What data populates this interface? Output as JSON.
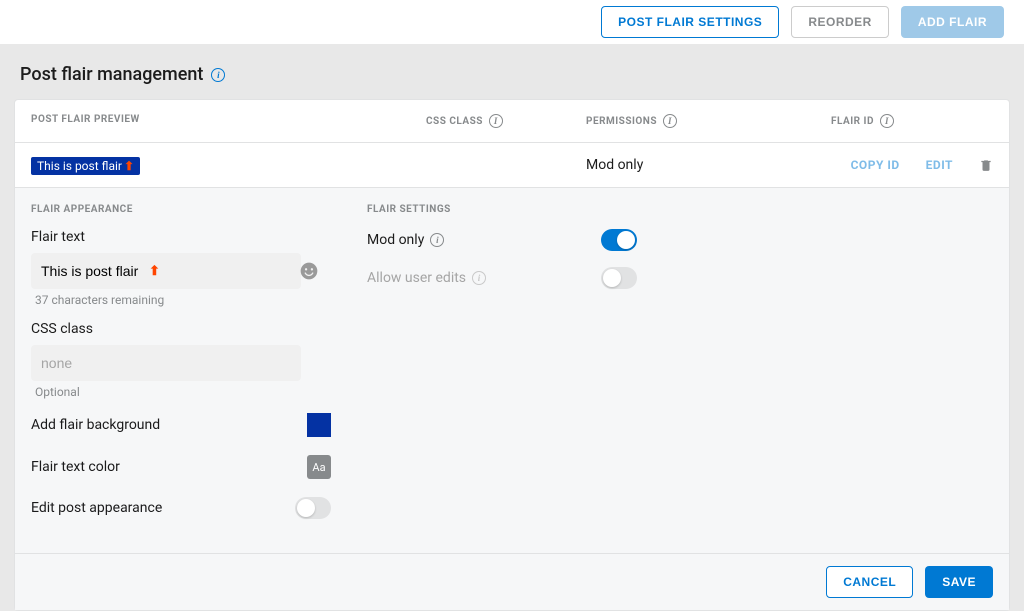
{
  "topbar": {
    "post_flair_settings": "POST FLAIR SETTINGS",
    "reorder": "REORDER",
    "add_flair": "ADD FLAIR"
  },
  "page_title": "Post flair management",
  "columns": {
    "preview": "POST FLAIR PREVIEW",
    "css": "CSS CLASS",
    "perm": "PERMISSIONS",
    "flid": "FLAIR ID"
  },
  "row": {
    "flair_text": "This is post flair",
    "permission": "Mod only",
    "copy_id": "COPY ID",
    "edit": "EDIT"
  },
  "appearance": {
    "header": "FLAIR APPEARANCE",
    "flair_text_label": "Flair text",
    "flair_text_value": "This is post flair",
    "chars_remaining": "37 characters remaining",
    "css_class_label": "CSS class",
    "css_class_placeholder": "none",
    "css_class_helper": "Optional",
    "add_bg_label": "Add flair background",
    "text_color_label": "Flair text color",
    "text_color_swatch": "Aa",
    "edit_post_appearance": "Edit post appearance",
    "bg_color": "#0432a3"
  },
  "settings": {
    "header": "FLAIR SETTINGS",
    "mod_only_label": "Mod only",
    "mod_only_on": true,
    "allow_user_edits_label": "Allow user edits",
    "allow_user_edits_on": false
  },
  "footer": {
    "cancel": "CANCEL",
    "save": "SAVE"
  }
}
